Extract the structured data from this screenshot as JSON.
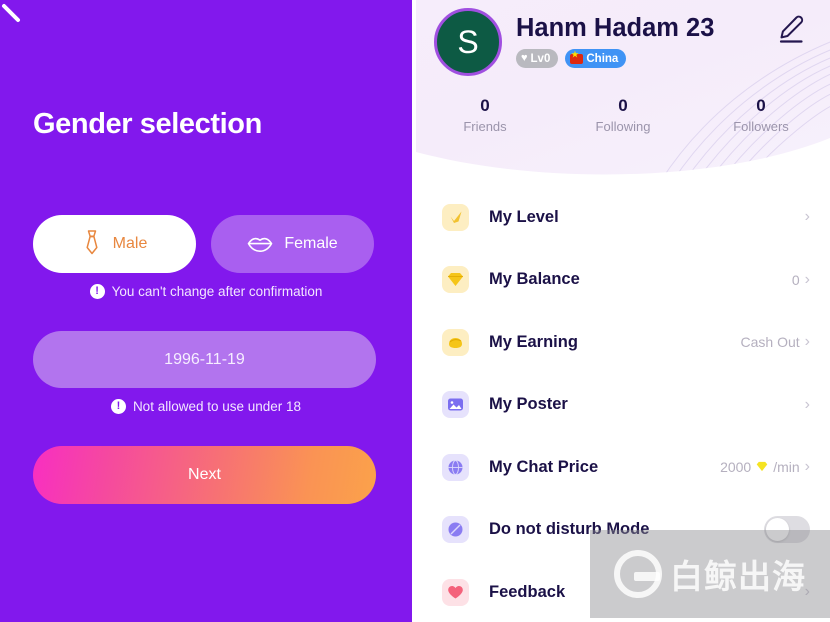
{
  "left": {
    "back_icon": "back-arrow-icon",
    "title": "Gender selection",
    "male": {
      "label": "Male",
      "icon": "necktie-icon",
      "selected": true
    },
    "female": {
      "label": "Female",
      "icon": "lips-icon",
      "selected": false
    },
    "gender_note": "You can't change after confirmation",
    "age_note": "Not allowed to use under 18",
    "note_icon": "!",
    "birthdate": "1996-11-19",
    "next_label": "Next",
    "colors": {
      "background": "#8218ed",
      "male_selected_bg": "#ffffff",
      "male_text": "#e8873f",
      "female_bg": "#a95ff0",
      "date_bg": "#b274ee",
      "next_gradient_from": "#f82ec2",
      "next_gradient_to": "#fba24a"
    }
  },
  "right": {
    "avatar_letter": "S",
    "user_name": "Hanm Hadam 23",
    "badges": [
      {
        "text": "Lv0",
        "icon": "heart-icon",
        "color": "#b9b9bf"
      },
      {
        "text": "China",
        "icon": "china-flag-icon",
        "color": "#3f93f5"
      }
    ],
    "edit_icon": "pencil-edit-icon",
    "stats": [
      {
        "value": "0",
        "label": "Friends"
      },
      {
        "value": "0",
        "label": "Following"
      },
      {
        "value": "0",
        "label": "Followers"
      }
    ],
    "menu": [
      {
        "label": "My Level",
        "icon": "check-mark-icon",
        "icon_glyph": "✔",
        "icon_tone": "gold",
        "value": "",
        "chevron": "›",
        "toggle": false
      },
      {
        "label": "My Balance",
        "icon": "diamond-icon",
        "icon_glyph": "◆",
        "icon_tone": "gold",
        "value": "0",
        "chevron": "›",
        "toggle": false
      },
      {
        "label": "My Earning",
        "icon": "money-hand-icon",
        "icon_glyph": "✋",
        "icon_tone": "gold",
        "value": "Cash Out",
        "chevron": "›",
        "toggle": false
      },
      {
        "label": "My Poster",
        "icon": "image-icon",
        "icon_glyph": "▣",
        "icon_tone": "violet",
        "value": "",
        "chevron": "›",
        "toggle": false
      },
      {
        "label": "My Chat Price",
        "icon": "chat-globe-icon",
        "icon_glyph": "●",
        "icon_tone": "violet",
        "value": "2000",
        "unit": "/min",
        "unit_icon": "◆",
        "chevron": "›",
        "toggle": false
      },
      {
        "label": "Do not disturb Mode",
        "icon": "moon-icon",
        "icon_glyph": "◐",
        "icon_tone": "violet",
        "value": "",
        "chevron": "",
        "toggle": true
      },
      {
        "label": "Feedback",
        "icon": "heart-icon",
        "icon_glyph": "♥",
        "icon_tone": "rose",
        "value": "",
        "chevron": "›",
        "toggle": false
      }
    ],
    "colors": {
      "header_bg": "#f6edfb",
      "text_primary": "#1b1147",
      "text_muted": "#b5b0bf",
      "avatar_bg": "#0d5a44",
      "avatar_ring": "#a04fe0"
    }
  },
  "watermark": {
    "text": "白鲸出海",
    "logo": "whale-g-logo"
  }
}
